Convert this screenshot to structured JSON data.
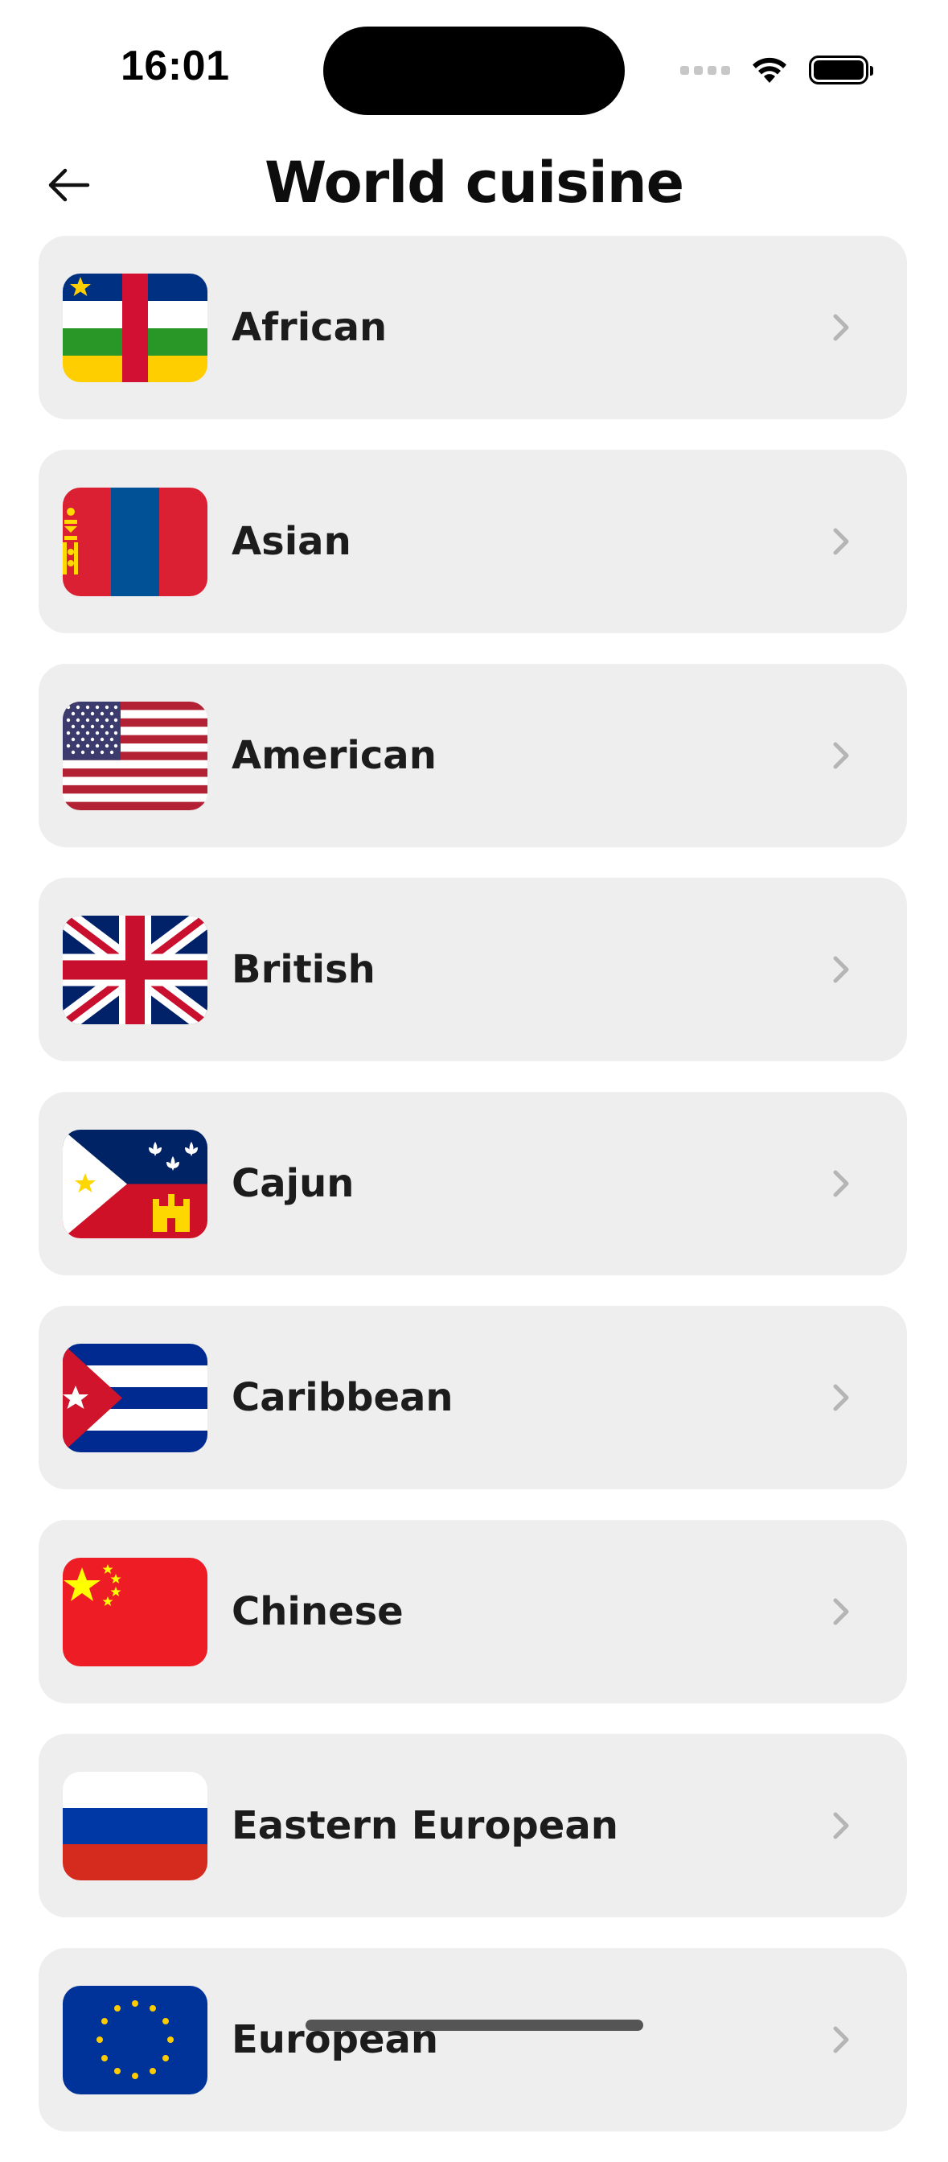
{
  "status_bar": {
    "time": "16:01",
    "icons": [
      "cellular-signal-icon",
      "wifi-icon",
      "battery-icon"
    ]
  },
  "header": {
    "title": "World cuisine",
    "back_icon": "arrow-left-icon"
  },
  "colors": {
    "card_background": "#eeeeee",
    "chevron": "#b5b5b5",
    "text": "#1c1c1c"
  },
  "cuisines": [
    {
      "label": "African",
      "flag": "central-african-republic-flag-icon"
    },
    {
      "label": "Asian",
      "flag": "mongolia-flag-icon"
    },
    {
      "label": "American",
      "flag": "united-states-flag-icon"
    },
    {
      "label": "British",
      "flag": "united-kingdom-flag-icon"
    },
    {
      "label": "Cajun",
      "flag": "acadiana-flag-icon"
    },
    {
      "label": "Caribbean",
      "flag": "cuba-flag-icon"
    },
    {
      "label": "Chinese",
      "flag": "china-flag-icon"
    },
    {
      "label": "Eastern European",
      "flag": "russia-flag-icon"
    },
    {
      "label": "European",
      "flag": "european-union-flag-icon"
    }
  ]
}
